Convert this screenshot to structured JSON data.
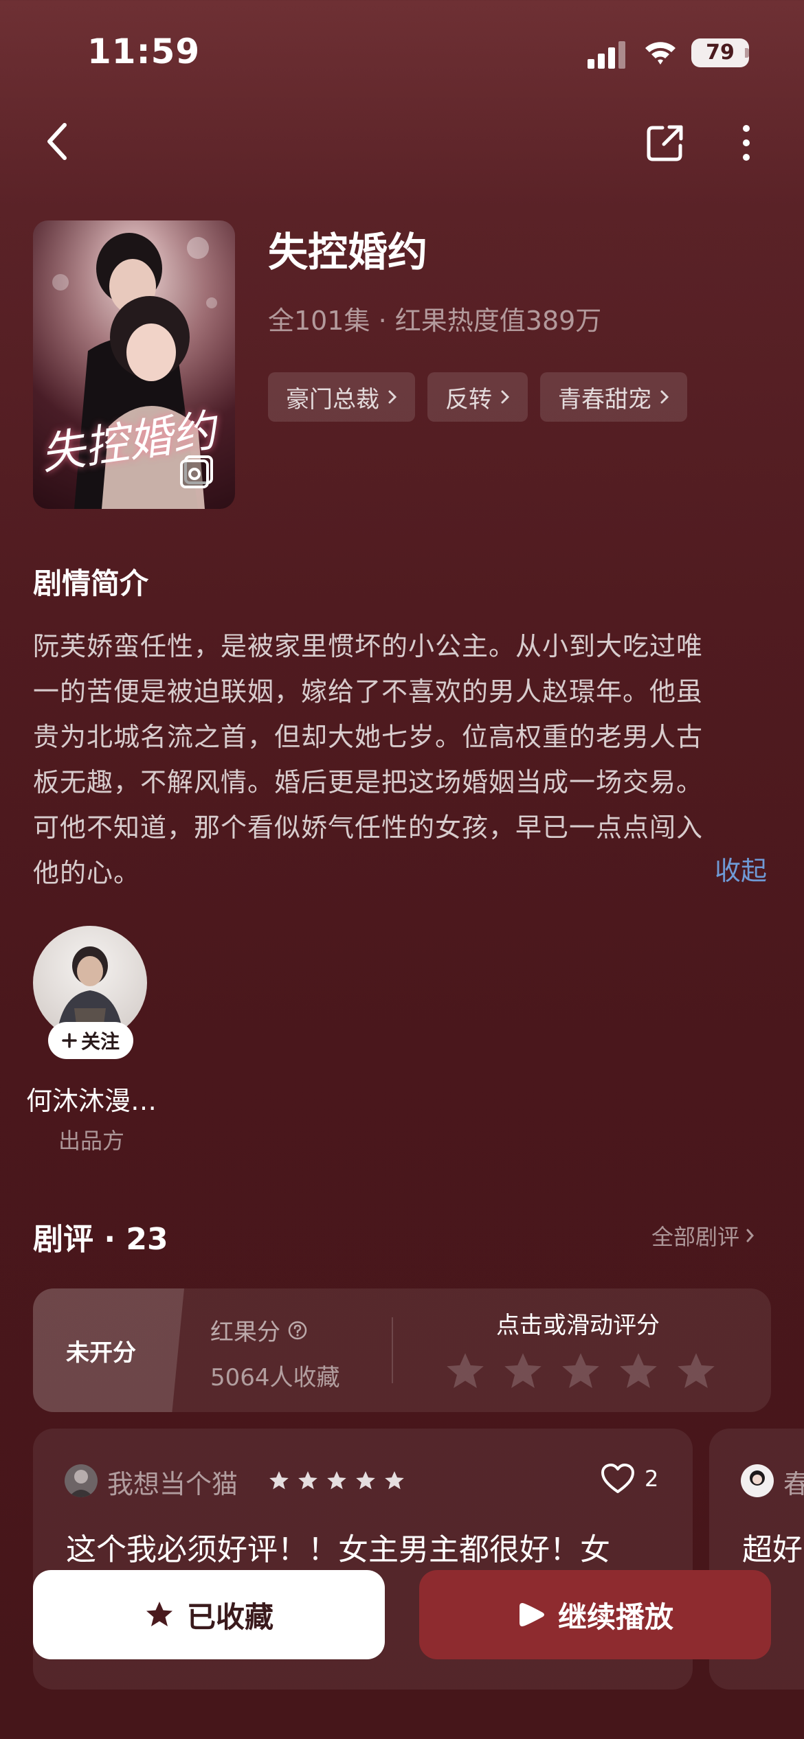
{
  "status_bar": {
    "time": "11:59",
    "battery": "79"
  },
  "drama": {
    "title": "失控婚约",
    "meta": "全101集 · 红果热度值389万",
    "tags": [
      "豪门总裁",
      "反转",
      "青春甜宠"
    ],
    "cover_title": "失控婚约"
  },
  "synopsis": {
    "heading": "剧情简介",
    "lines": [
      "阮芙娇蛮任性，是被家里惯坏的小公主。从小到大吃过唯",
      "一的苦便是被迫联姻，嫁给了不喜欢的男人赵璟年。他虽",
      "贵为北城名流之首，但却大她七岁。位高权重的老男人古",
      "板无趣，不解风情。婚后更是把这场婚姻当成一场交易。",
      "可他不知道，那个看似娇气任性的女孩，早已一点点闯入",
      "他的心。"
    ],
    "collapse_label": "收起"
  },
  "producer": {
    "follow_label": "关注",
    "name": "何沐沐漫…",
    "role": "出品方"
  },
  "reviews": {
    "heading": "剧评 · 23",
    "all_label": "全部剧评",
    "rating": {
      "unrated_label": "未开分",
      "score_label": "红果分",
      "fav_count": "5064人收藏",
      "rate_hint": "点击或滑动评分",
      "stars_total": 5
    },
    "items": [
      {
        "user": "我想当个猫",
        "stars": 5,
        "likes": "2",
        "text": "这个我必须好评！！女主男主都很好！女"
      },
      {
        "user": "春",
        "text": "超好"
      }
    ]
  },
  "actions": {
    "favorite_label": "已收藏",
    "play_label": "继续播放"
  },
  "colors": {
    "background": "#501b20",
    "accent_link": "#6f9ad6",
    "play_button": "#8e2b2f"
  }
}
